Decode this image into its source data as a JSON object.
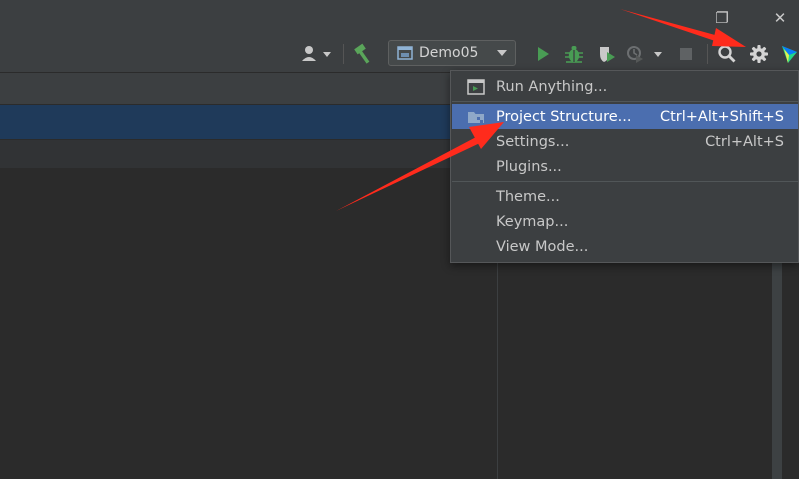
{
  "window": {
    "restore_icon": "❐",
    "close_icon": "✕"
  },
  "toolbar": {
    "run_config": "Demo05"
  },
  "menu": {
    "items": [
      {
        "label": "Run Anything...",
        "shortcut": ""
      },
      {
        "label": "Project Structure...",
        "shortcut": "Ctrl+Alt+Shift+S"
      },
      {
        "label": "Settings...",
        "shortcut": "Ctrl+Alt+S"
      },
      {
        "label": "Plugins...",
        "shortcut": ""
      },
      {
        "label": "Theme...",
        "shortcut": ""
      },
      {
        "label": "Keymap...",
        "shortcut": ""
      },
      {
        "label": "View Mode...",
        "shortcut": ""
      }
    ]
  },
  "colors": {
    "accent_selection": "#4b6eaf",
    "annotation_arrow": "#ff2b1c",
    "run_green": "#499c54"
  }
}
